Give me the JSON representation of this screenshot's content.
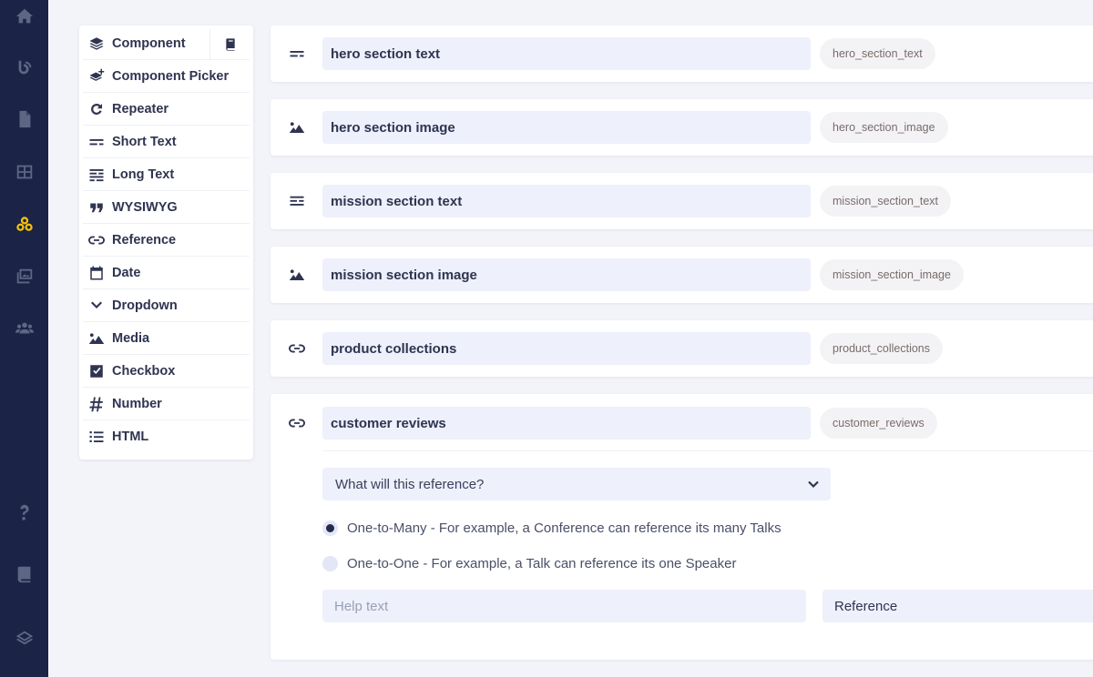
{
  "rail": {
    "items": [
      {
        "icon": "home-icon"
      },
      {
        "icon": "blog-icon"
      },
      {
        "icon": "page-icon"
      },
      {
        "icon": "layout-icon"
      },
      {
        "icon": "components-icon",
        "active": true
      },
      {
        "icon": "media-icon"
      },
      {
        "icon": "users-icon"
      },
      {
        "icon": "help-icon"
      },
      {
        "icon": "docs-icon"
      },
      {
        "icon": "layers-icon"
      }
    ],
    "accent": "#f4c10c",
    "background": "#1b2346"
  },
  "picker": {
    "items": [
      {
        "label": "Component",
        "icon": "stack-icon"
      },
      {
        "label": "Component Picker",
        "icon": "stack-plus-icon"
      },
      {
        "label": "Repeater",
        "icon": "repeat-icon"
      },
      {
        "label": "Short Text",
        "icon": "short-text-icon"
      },
      {
        "label": "Long Text",
        "icon": "long-text-icon"
      },
      {
        "label": "WYSIWYG",
        "icon": "quote-icon"
      },
      {
        "label": "Reference",
        "icon": "link-icon"
      },
      {
        "label": "Date",
        "icon": "calendar-icon"
      },
      {
        "label": "Dropdown",
        "icon": "chevron-down-icon"
      },
      {
        "label": "Media",
        "icon": "image-icon"
      },
      {
        "label": "Checkbox",
        "icon": "checkbox-icon"
      },
      {
        "label": "Number",
        "icon": "hash-icon"
      },
      {
        "label": "HTML",
        "icon": "list-icon"
      }
    ]
  },
  "fields": [
    {
      "name": "hero section text",
      "key": "hero_section_text",
      "icon": "short-text-icon"
    },
    {
      "name": "hero section image",
      "key": "hero_section_image",
      "icon": "image-icon"
    },
    {
      "name": "mission section text",
      "key": "mission_section_text",
      "icon": "long-text-icon"
    },
    {
      "name": "mission section image",
      "key": "mission_section_image",
      "icon": "image-icon"
    },
    {
      "name": "product collections",
      "key": "product_collections",
      "icon": "link-icon"
    },
    {
      "name": "customer reviews",
      "key": "customer_reviews",
      "icon": "link-icon"
    }
  ],
  "reference_settings": {
    "select_label": "What will this reference?",
    "options": [
      {
        "label": "One-to-Many - For example, a Conference can reference its many Talks",
        "selected": true
      },
      {
        "label": "One-to-One - For example, a Talk can reference its one Speaker",
        "selected": false
      }
    ],
    "help_text_placeholder": "Help text",
    "type_value": "Reference"
  }
}
